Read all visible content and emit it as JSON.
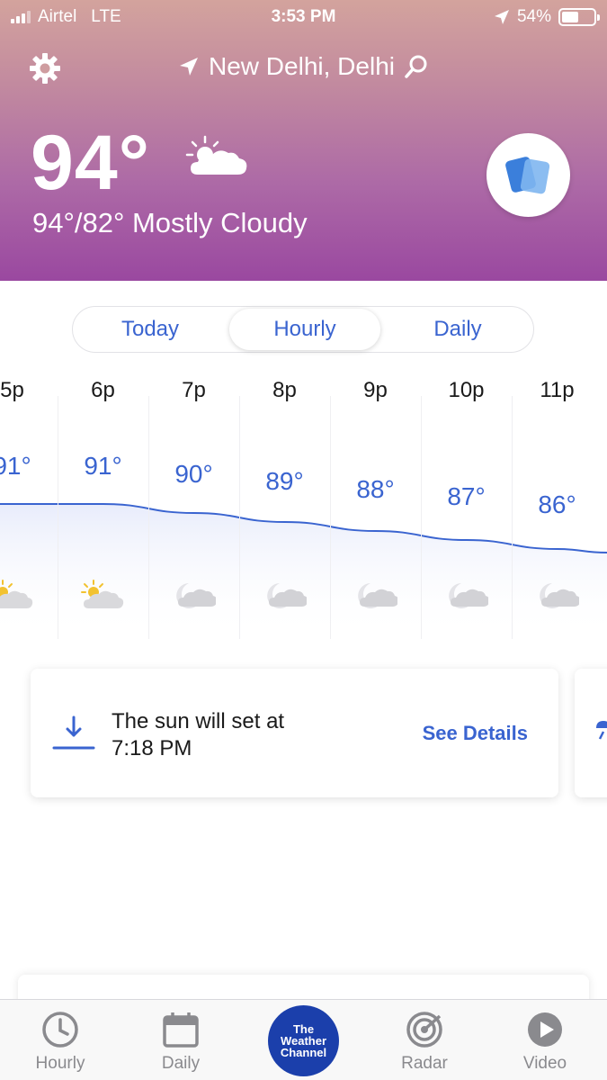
{
  "status_bar": {
    "carrier": "Airtel",
    "network": "LTE",
    "time": "3:53 PM",
    "battery": "54%",
    "battery_level": 0.54
  },
  "header": {
    "location": "New Delhi, Delhi",
    "current_temp": "94°",
    "summary": "94°/82° Mostly Cloudy",
    "condition_icon": "partly-cloudy-day-icon"
  },
  "segment": {
    "tabs": [
      "Today",
      "Hourly",
      "Daily"
    ],
    "active": "Hourly"
  },
  "hourly": [
    {
      "time": "5p",
      "temp": "91°",
      "value": 91,
      "icon": "partly-cloudy-day-icon"
    },
    {
      "time": "6p",
      "temp": "91°",
      "value": 91,
      "icon": "partly-cloudy-day-icon"
    },
    {
      "time": "7p",
      "temp": "90°",
      "value": 90,
      "icon": "partly-cloudy-night-icon"
    },
    {
      "time": "8p",
      "temp": "89°",
      "value": 89,
      "icon": "partly-cloudy-night-icon"
    },
    {
      "time": "9p",
      "temp": "88°",
      "value": 88,
      "icon": "partly-cloudy-night-icon"
    },
    {
      "time": "10p",
      "temp": "87°",
      "value": 87,
      "icon": "partly-cloudy-night-icon"
    },
    {
      "time": "11p",
      "temp": "86°",
      "value": 86,
      "icon": "partly-cloudy-night-icon"
    }
  ],
  "sunset_card": {
    "line1": "The sun will set at",
    "line2": "7:18 PM",
    "action": "See Details"
  },
  "tabbar": {
    "items": [
      "Hourly",
      "Daily",
      "Radar",
      "Video"
    ],
    "logo": [
      "The",
      "Weather",
      "Channel"
    ]
  },
  "colors": {
    "accent": "#3a64d0",
    "header_top": "#d3a39d",
    "header_bottom": "#9a48a0",
    "logo_blue": "#1b3fab"
  }
}
